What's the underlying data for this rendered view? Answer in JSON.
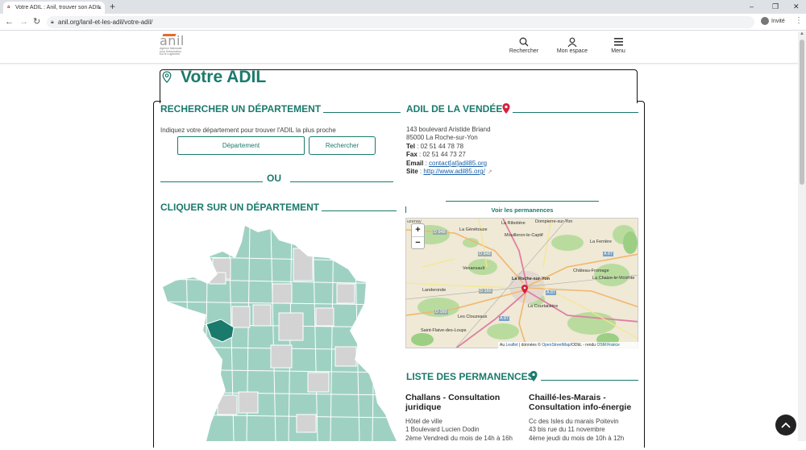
{
  "browser": {
    "tab_title": "Votre ADIL : Anil, trouver son ADIL",
    "tab_close": "×",
    "new_tab": "+",
    "url": "anil.org/lanil-et-les-adil/votre-adil/",
    "profile_label": "Invité",
    "window_controls": [
      "–",
      "❐",
      "✕"
    ]
  },
  "header": {
    "logo_text": "anil",
    "logo_tagline": [
      "Agence Nationale",
      "pour l'information",
      "sur le Logement"
    ],
    "nav": [
      {
        "label": "Rechercher",
        "icon": "search-icon"
      },
      {
        "label": "Mon espace",
        "icon": "user-icon"
      },
      {
        "label": "Menu",
        "icon": "menu-icon"
      }
    ]
  },
  "page": {
    "title": "Votre ADIL"
  },
  "search_section": {
    "heading": "RECHERCHER UN DÉPARTEMENT",
    "instruction": "Indiquez votre département pour trouver l'ADIL la plus proche",
    "input_placeholder": "Département",
    "button_label": "Rechercher",
    "or_label": "OU",
    "map_heading": "CLIQUER SUR UN DÉPARTEMENT"
  },
  "adil_section": {
    "heading": "ADIL DE LA VENDÉE",
    "address_line1": "143 boulevard Aristide Briand",
    "address_line2": "85000 La Roche-sur-Yon",
    "tel_label": "Tel",
    "tel": " : 02 51 44 78 78",
    "fax_label": "Fax",
    "fax": " : 02 51 44 73 27",
    "email_label": "Email",
    "email_sep": " : ",
    "email": "contact[at]adil85.org",
    "site_label": "Site",
    "site_sep": " : ",
    "site": "http://www.adil85.org/",
    "permanences_link": "Voir les permanences"
  },
  "map": {
    "zoom_in": "+",
    "zoom_out": "−",
    "attribution_prefix": "Au ",
    "attribution_leaflet": "Leaflet",
    "attribution_mid": " | données © ",
    "attribution_osm": "OpenStreetMap",
    "attribution_tail": "/ODbL - rendu ",
    "attribution_osmfr": "OSM France",
    "places": [
      "La Génétouze",
      "La Ribotière",
      "Dompierre-sur-Yon",
      "Mouilleron-le-Captif",
      "La Ferrière",
      "Venansault",
      "Château-Fromage",
      "La Roche-sur-Yon",
      "La Chaize-le-Vicomte",
      "Landeronde",
      "Les Clouzeaux",
      "La Courtaisière",
      "Saint-Flaive-des-Loups"
    ],
    "roads": [
      "D 948",
      "D 948",
      "A 87",
      "D 160",
      "D 160",
      "A 87",
      "A 87"
    ]
  },
  "permanences": {
    "heading": "LISTE DES PERMANENCES",
    "items": [
      {
        "title": "Challans - Consultation juridique",
        "line1": "Hôtel de ville",
        "line2": "1 Boulevard Lucien Dodin",
        "line3": "2ème Vendredi du mois de 14h à 16h"
      },
      {
        "title": "Chaillé-les-Marais - Consultation info-énergie",
        "line1": "Cc des Isles du marais Poitevin",
        "line2": "43 bis rue du 11 novembre",
        "line3": "4ème jeudi du mois de 10h à 12h"
      }
    ]
  },
  "colors": {
    "brand_green": "#1a7a6c",
    "department_fill": "#9fd1c3",
    "department_grey": "#d3d3d3",
    "selected_department": "#1a7a6c",
    "pin_red": "#d6213c"
  }
}
